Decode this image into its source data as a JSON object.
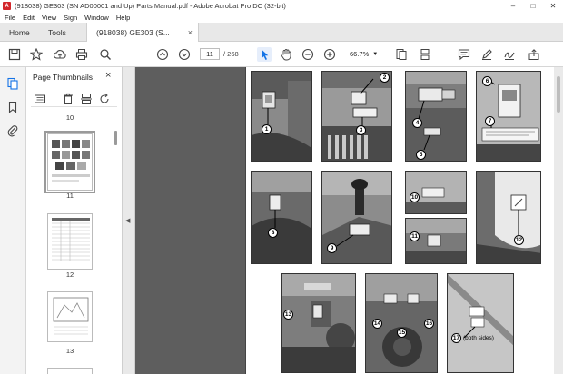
{
  "window": {
    "title": "(918038) GE303 (SN AD00001 and Up) Parts Manual.pdf - Adobe Acrobat Pro DC (32-bit)",
    "app_icon_glyph": "A",
    "controls": [
      "–",
      "□",
      "✕"
    ]
  },
  "menu": [
    "File",
    "Edit",
    "View",
    "Sign",
    "Window",
    "Help"
  ],
  "tabs": {
    "home": "Home",
    "tools": "Tools",
    "document": "(918038) GE303 (S...",
    "close": "×"
  },
  "toolbar": {
    "current_page": "11",
    "page_total": "/ 268",
    "zoom": "66.7%",
    "zoom_caret": "▼"
  },
  "panel": {
    "title": "Page Thumbnails",
    "close": "×",
    "thumbnails": [
      {
        "label": "10"
      },
      {
        "label": "11",
        "selected": true
      },
      {
        "label": "12"
      },
      {
        "label": "13"
      }
    ]
  },
  "splitter": {
    "arrow": "◀"
  },
  "document": {
    "callouts": [
      "1",
      "2",
      "3",
      "4",
      "5",
      "6",
      "7",
      "8",
      "9",
      "10",
      "11",
      "12",
      "13",
      "14",
      "15",
      "16",
      "17"
    ],
    "note": "(both sides)"
  },
  "colors": {
    "accent": "#1473e6",
    "brand_red": "#d3272b",
    "viewer_bg": "#5e5e5e"
  }
}
